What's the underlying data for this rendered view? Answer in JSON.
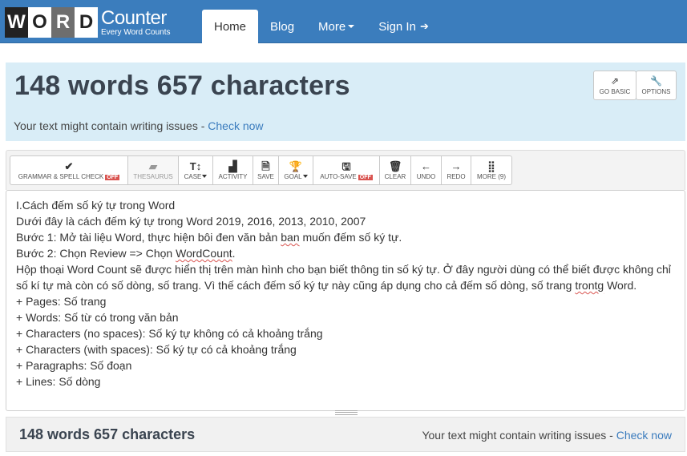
{
  "brand": {
    "letters": [
      "W",
      "O",
      "R",
      "D"
    ],
    "name": "Counter",
    "tagline": "Every Word Counts"
  },
  "nav": {
    "home": "Home",
    "blog": "Blog",
    "more": "More",
    "signin": "Sign In"
  },
  "stats": {
    "headline": "148 words 657 characters",
    "issues_text": "Your text might contain writing issues - ",
    "check_link": "Check now",
    "go_basic": "GO BASIC",
    "options": "OPTIONS"
  },
  "toolbar": {
    "grammar": "GRAMMAR & SPELL CHECK",
    "grammar_badge": "OFF",
    "thesaurus": "THESAURUS",
    "case": "CASE",
    "activity": "ACTIVITY",
    "save": "SAVE",
    "goal": "GOAL",
    "autosave": "AUTO-SAVE",
    "autosave_badge": "OFF",
    "clear": "CLEAR",
    "undo": "UNDO",
    "redo": "REDO",
    "more": "MORE (9)"
  },
  "editor": {
    "lines": [
      "I.Cách đếm số ký tự trong Word",
      "Dưới đây là cách đếm ký tự trong Word 2019, 2016, 2013, 2010, 2007",
      "Bước 1: Mở tài liệu Word, thực hiện bôi đen văn bản ",
      "ban",
      " muốn đếm số ký tự.",
      "Bước 2: Chọn Review => Chọn ",
      "WordCount",
      ".",
      "Hộp thoại Word Count sẽ được hiển thị trên màn hình cho bạn biết thông tin số ký tự. Ở đây người dùng có thể biết được không chỉ số kí tự mà còn có số dòng, số trang. Vì thế cách đếm số ký tự này cũng áp dụng cho cả đếm số dòng, số trang ",
      "trontg",
      " Word.",
      "+ Pages: Số trang",
      "+ Words: Số từ có trong văn bản",
      "+ Characters (no spaces): Số ký tự không có cả khoảng trắng",
      "+ Characters (with spaces): Số ký tự có cả khoảng trắng",
      "+ Paragraphs: Số đoạn",
      "+ Lines: Số dòng"
    ]
  },
  "footer": {
    "headline": "148 words 657 characters",
    "issues_text": "Your text might contain writing issues - ",
    "check_link": "Check now"
  }
}
